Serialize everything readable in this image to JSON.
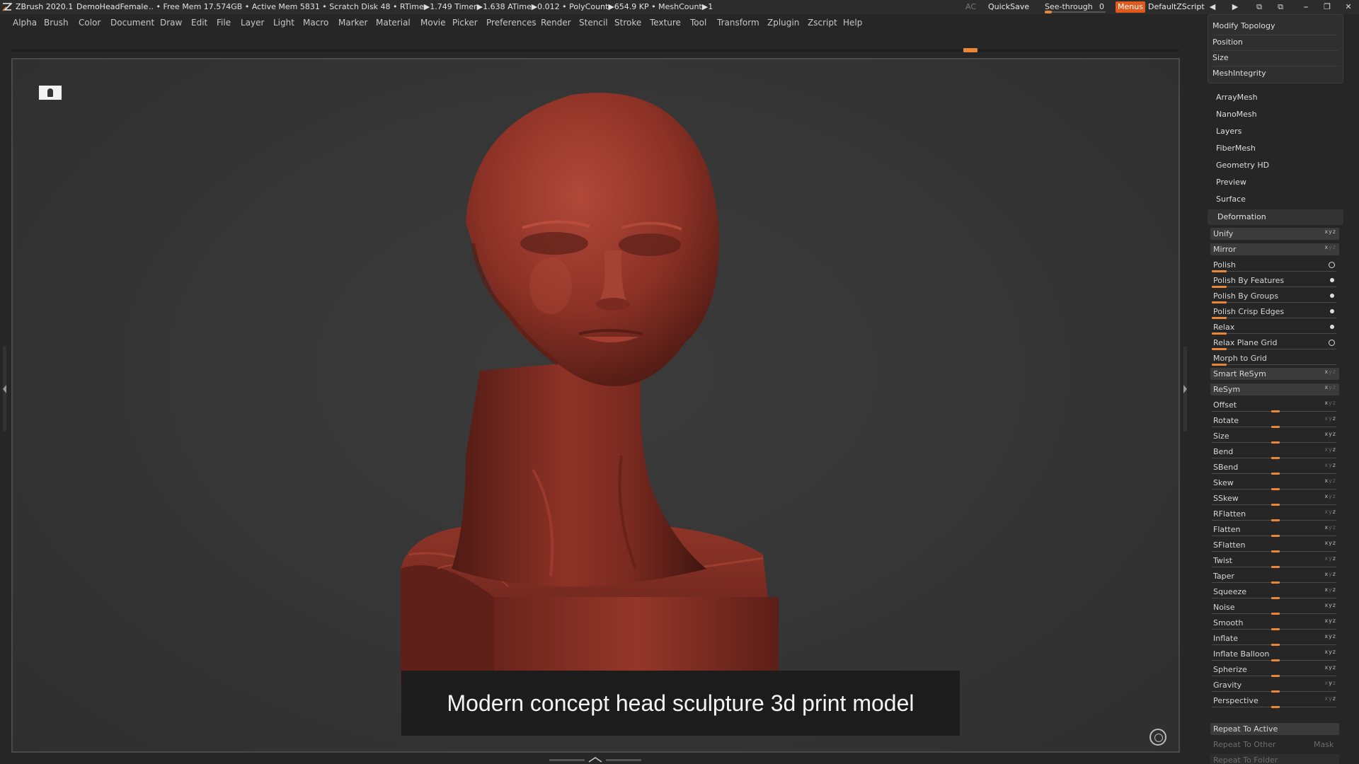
{
  "titlebar": {
    "app": "ZBrush 2020.1",
    "document": "DemoHeadFemale",
    "stats": "  .. • Free Mem 17.574GB • Active Mem 5831 • Scratch Disk 48 •  RTime▶1.749 Timer▶1.638 ATime▶0.012 • PolyCount▶654.9 KP • MeshCount▶1",
    "ac": "AC",
    "quicksave": "QuickSave",
    "see_through_label": "See-through",
    "see_through_value": "0",
    "see_through_level": 0,
    "menus_label": "Menus",
    "script_label": "DefaultZScript",
    "accent": "#e05a1e"
  },
  "menubar": [
    "Alpha",
    "Brush",
    "Color",
    "Document",
    "Draw",
    "Edit",
    "File",
    "Layer",
    "Light",
    "Macro",
    "Marker",
    "Material",
    "Movie",
    "Picker",
    "Preferences",
    "Render",
    "Stencil",
    "Stroke",
    "Texture",
    "Tool",
    "Transform",
    "Zplugin",
    "Zscript",
    "Help"
  ],
  "caption": "Modern concept head sculpture 3d print model",
  "tray": {
    "geometry_items": [
      "Modify Topology",
      "Position",
      "Size",
      "MeshIntegrity"
    ],
    "subpalettes": [
      "ArrayMesh",
      "NanoMesh",
      "Layers",
      "FiberMesh",
      "Geometry HD",
      "Preview",
      "Surface"
    ],
    "deformation_title": "Deformation",
    "deformations": [
      {
        "label": "Unify",
        "kind": "button",
        "axes": "xyz"
      },
      {
        "label": "Mirror",
        "kind": "button",
        "axes": "x"
      },
      {
        "label": "Polish",
        "kind": "slider",
        "level": 0.04,
        "toggle": "ring"
      },
      {
        "label": "Polish By Features",
        "kind": "slider",
        "level": 0.04,
        "toggle": "dot"
      },
      {
        "label": "Polish By Groups",
        "kind": "slider",
        "level": 0.04,
        "toggle": "dot"
      },
      {
        "label": "Polish Crisp Edges",
        "kind": "slider",
        "level": 0.04,
        "toggle": "dot"
      },
      {
        "label": "Relax",
        "kind": "slider",
        "level": 0.04,
        "toggle": "dot"
      },
      {
        "label": "Relax Plane Grid",
        "kind": "slider",
        "level": 0.04,
        "toggle": "ring"
      },
      {
        "label": "Morph to Grid",
        "kind": "slider",
        "level": 0.04,
        "toggle": ""
      },
      {
        "label": "Smart ReSym",
        "kind": "button",
        "axes": "x"
      },
      {
        "label": "ReSym",
        "kind": "button",
        "axes": "x"
      },
      {
        "label": "Offset",
        "kind": "slider",
        "level": 0.5,
        "axes": "x"
      },
      {
        "label": "Rotate",
        "kind": "slider",
        "level": 0.5,
        "axes": "z"
      },
      {
        "label": "Size",
        "kind": "slider",
        "level": 0.5,
        "axes": "xyz"
      },
      {
        "label": "Bend",
        "kind": "slider",
        "level": 0.5,
        "axes": "z"
      },
      {
        "label": "SBend",
        "kind": "slider",
        "level": 0.5,
        "axes": "z"
      },
      {
        "label": "Skew",
        "kind": "slider",
        "level": 0.5,
        "axes": "x"
      },
      {
        "label": "SSkew",
        "kind": "slider",
        "level": 0.5,
        "axes": "x"
      },
      {
        "label": "RFlatten",
        "kind": "slider",
        "level": 0.5,
        "axes": "z"
      },
      {
        "label": "Flatten",
        "kind": "slider",
        "level": 0.5,
        "axes": "x"
      },
      {
        "label": "SFlatten",
        "kind": "slider",
        "level": 0.5,
        "axes": "xyz"
      },
      {
        "label": "Twist",
        "kind": "slider",
        "level": 0.5,
        "axes": "z"
      },
      {
        "label": "Taper",
        "kind": "slider",
        "level": 0.5,
        "axes": "xz"
      },
      {
        "label": "Squeeze",
        "kind": "slider",
        "level": 0.5,
        "axes": "xz"
      },
      {
        "label": "Noise",
        "kind": "slider",
        "level": 0.5,
        "axes": "xyz"
      },
      {
        "label": "Smooth",
        "kind": "slider",
        "level": 0.5,
        "axes": "xyz"
      },
      {
        "label": "Inflate",
        "kind": "slider",
        "level": 0.5,
        "axes": "xyz"
      },
      {
        "label": "Inflate Balloon",
        "kind": "slider",
        "level": 0.5,
        "axes": "xyz"
      },
      {
        "label": "Spherize",
        "kind": "slider",
        "level": 0.5,
        "axes": "xyz"
      },
      {
        "label": "Gravity",
        "kind": "slider",
        "level": 0.5,
        "axes": "y"
      },
      {
        "label": "Perspective",
        "kind": "slider",
        "level": 0.5,
        "axes": "z"
      }
    ],
    "repeat_to_active": "Repeat To Active",
    "repeat_to_other": "Repeat To Other",
    "mask": "Mask",
    "repeat_to_folder": "Repeat To Folder"
  },
  "colors": {
    "slider_accent": "#e8873a",
    "sculpt_base": "#8e3226"
  }
}
